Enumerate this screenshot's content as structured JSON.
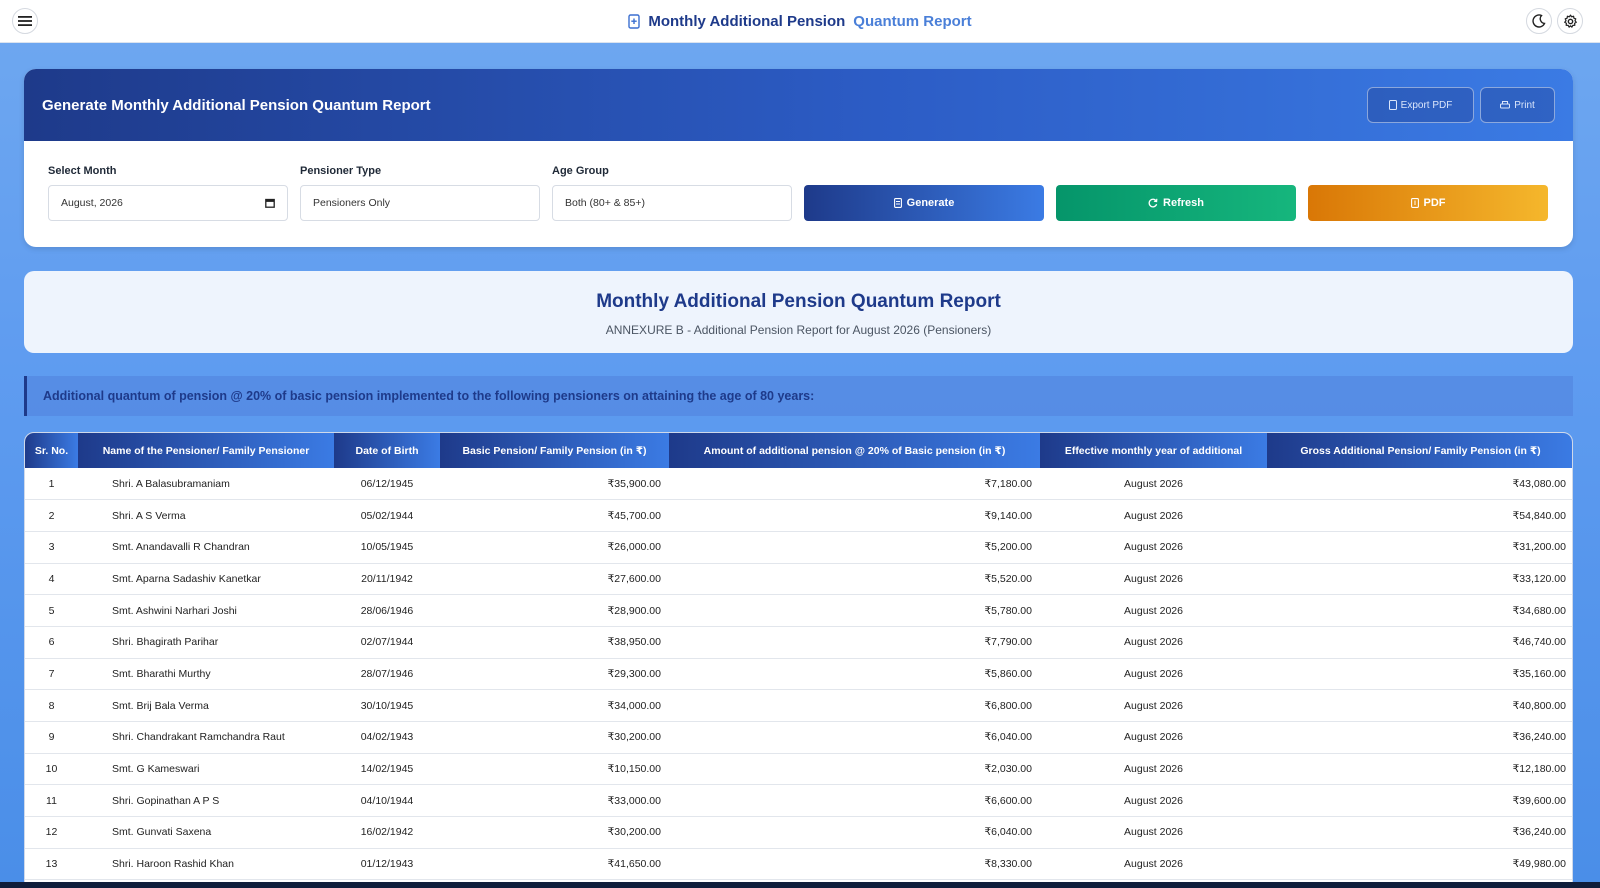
{
  "topbar": {
    "title_main": "Monthly Additional Pension",
    "title_accent": "Quantum Report"
  },
  "generate_card": {
    "title": "Generate Monthly Additional Pension Quantum Report",
    "export_pdf_label": "Export PDF",
    "print_label": "Print",
    "filters": {
      "month_label": "Select Month",
      "month_value": "August, 2026",
      "type_label": "Pensioner Type",
      "type_value": "Pensioners Only",
      "age_label": "Age Group",
      "age_value": "Both (80+ & 85+)"
    },
    "generate_label": "Generate",
    "refresh_label": "Refresh",
    "pdf_label": "PDF"
  },
  "report": {
    "title": "Monthly Additional Pension Quantum Report",
    "subtitle": "ANNEXURE B - Additional Pension Report for August 2026 (Pensioners)",
    "banner": "Additional quantum of pension @ 20% of basic pension implemented to the following pensioners on attaining the age of 80 years:"
  },
  "table": {
    "headers": [
      "Sr. No.",
      "Name of the Pensioner/ Family Pensioner",
      "Date of Birth",
      "Basic Pension/ Family Pension (in ₹)",
      "Amount of additional pension @ 20% of Basic pension (in ₹)",
      "Effective monthly year of additional",
      "Gross Additional Pension/ Family Pension (in ₹)"
    ],
    "rows": [
      [
        "1",
        "Shri. A Balasubramaniam",
        "06/12/1945",
        "₹35,900.00",
        "₹7,180.00",
        "August 2026",
        "₹43,080.00"
      ],
      [
        "2",
        "Shri. A S Verma",
        "05/02/1944",
        "₹45,700.00",
        "₹9,140.00",
        "August 2026",
        "₹54,840.00"
      ],
      [
        "3",
        "Smt. Anandavalli R Chandran",
        "10/05/1945",
        "₹26,000.00",
        "₹5,200.00",
        "August 2026",
        "₹31,200.00"
      ],
      [
        "4",
        "Smt. Aparna Sadashiv Kanetkar",
        "20/11/1942",
        "₹27,600.00",
        "₹5,520.00",
        "August 2026",
        "₹33,120.00"
      ],
      [
        "5",
        "Smt. Ashwini Narhari Joshi",
        "28/06/1946",
        "₹28,900.00",
        "₹5,780.00",
        "August 2026",
        "₹34,680.00"
      ],
      [
        "6",
        "Shri. Bhagirath Parihar",
        "02/07/1944",
        "₹38,950.00",
        "₹7,790.00",
        "August 2026",
        "₹46,740.00"
      ],
      [
        "7",
        "Smt. Bharathi Murthy",
        "28/07/1946",
        "₹29,300.00",
        "₹5,860.00",
        "August 2026",
        "₹35,160.00"
      ],
      [
        "8",
        "Smt. Brij Bala Verma",
        "30/10/1945",
        "₹34,000.00",
        "₹6,800.00",
        "August 2026",
        "₹40,800.00"
      ],
      [
        "9",
        "Shri. Chandrakant Ramchandra Raut",
        "04/02/1943",
        "₹30,200.00",
        "₹6,040.00",
        "August 2026",
        "₹36,240.00"
      ],
      [
        "10",
        "Smt. G Kameswari",
        "14/02/1945",
        "₹10,150.00",
        "₹2,030.00",
        "August 2026",
        "₹12,180.00"
      ],
      [
        "11",
        "Shri. Gopinathan A P S",
        "04/10/1944",
        "₹33,000.00",
        "₹6,600.00",
        "August 2026",
        "₹39,600.00"
      ],
      [
        "12",
        "Smt. Gunvati Saxena",
        "16/02/1942",
        "₹30,200.00",
        "₹6,040.00",
        "August 2026",
        "₹36,240.00"
      ],
      [
        "13",
        "Shri. Haroon Rashid Khan",
        "01/12/1943",
        "₹41,650.00",
        "₹8,330.00",
        "August 2026",
        "₹49,980.00"
      ]
    ]
  }
}
